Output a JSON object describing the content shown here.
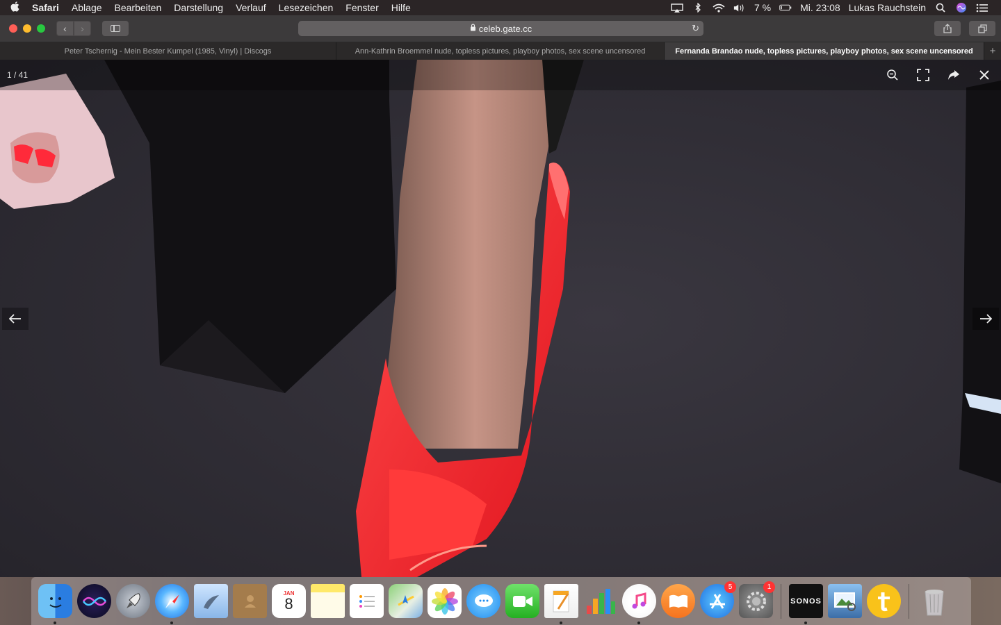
{
  "menubar": {
    "apple": "",
    "app_name": "Safari",
    "menus": [
      "Ablage",
      "Bearbeiten",
      "Darstellung",
      "Verlauf",
      "Lesezeichen",
      "Fenster",
      "Hilfe"
    ],
    "battery": "7 %",
    "clock": "Mi. 23:08",
    "user": "Lukas Rauchstein"
  },
  "toolbar": {
    "url": "celeb.gate.cc"
  },
  "tabs": [
    {
      "title": "Peter Tschernig - Mein Bester Kumpel (1985, Vinyl) | Discogs",
      "active": false
    },
    {
      "title": "Ann-Kathrin Broemmel nude, topless pictures, playboy photos, sex scene uncensored",
      "active": false
    },
    {
      "title": "Fernanda Brandao nude, topless pictures, playboy photos, sex scene uncensored",
      "active": true
    }
  ],
  "lightbox": {
    "counter": "1 / 41"
  },
  "dock": {
    "calendar_month": "JAN",
    "calendar_day": "8",
    "appstore_badge": "5",
    "settings_badge": "1",
    "sonos_label": "SONOS",
    "items": [
      "finder-icon",
      "siri-icon",
      "launchpad-icon",
      "safari-icon",
      "mail-icon",
      "contacts-icon",
      "calendar-icon",
      "notes-icon",
      "reminders-icon",
      "maps-icon",
      "photos-icon",
      "messages-icon",
      "facetime-icon",
      "pages-icon",
      "numbers-icon",
      "itunes-icon",
      "books-icon",
      "appstore-icon",
      "system-preferences-icon",
      "sonos-icon",
      "preview-icon",
      "trello-icon",
      "trash-icon"
    ]
  }
}
